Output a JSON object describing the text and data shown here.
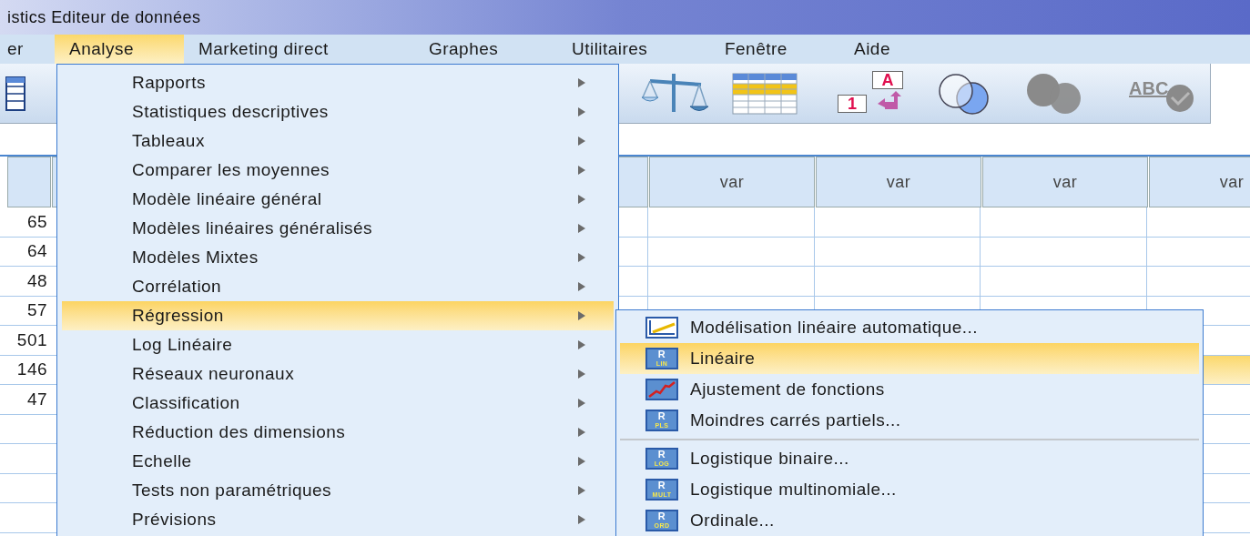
{
  "window": {
    "title": "istics Editeur de données"
  },
  "menu_bar": [
    {
      "label": "er",
      "selected": false
    },
    {
      "label": "Analyse",
      "selected": true
    },
    {
      "label": "Marketing direct",
      "selected": false
    },
    {
      "label": "Graphes",
      "selected": false
    },
    {
      "label": "Utilitaires",
      "selected": false
    },
    {
      "label": "Fenêtre",
      "selected": false
    },
    {
      "label": "Aide",
      "selected": false
    }
  ],
  "toolbar": [
    {
      "kind": "data-editor"
    },
    {
      "kind": "scale"
    },
    {
      "kind": "table"
    },
    {
      "kind": "value-labels",
      "labels": [
        "A",
        "1"
      ]
    },
    {
      "kind": "venn"
    },
    {
      "kind": "venn-disabled"
    },
    {
      "kind": "spell-check",
      "text": "ABC"
    }
  ],
  "grid": {
    "columns": [
      "var",
      "var",
      "var",
      "var"
    ],
    "rows": [
      {
        "column_1": "65",
        "selected": false
      },
      {
        "column_1": "64",
        "selected": false
      },
      {
        "column_1": "48",
        "selected": false
      },
      {
        "column_1": "57",
        "selected": false
      },
      {
        "column_1": "501",
        "selected": false
      },
      {
        "column_1": "146",
        "selected": true
      },
      {
        "column_1": "47",
        "selected": false
      }
    ]
  },
  "analyse_menu": {
    "items": [
      {
        "label": "Rapports",
        "selected": false
      },
      {
        "label": "Statistiques descriptives",
        "selected": false
      },
      {
        "label": "Tableaux",
        "selected": false
      },
      {
        "label": "Comparer les moyennes",
        "selected": false
      },
      {
        "label": "Modèle linéaire général",
        "selected": false
      },
      {
        "label": "Modèles linéaires généralisés",
        "selected": false
      },
      {
        "label": "Modèles Mixtes",
        "selected": false
      },
      {
        "label": "Corrélation",
        "selected": false
      },
      {
        "label": "Régression",
        "selected": true
      },
      {
        "label": "Log Linéaire",
        "selected": false
      },
      {
        "label": "Réseaux neuronaux",
        "selected": false
      },
      {
        "label": "Classification",
        "selected": false
      },
      {
        "label": "Réduction des dimensions",
        "selected": false
      },
      {
        "label": "Echelle",
        "selected": false
      },
      {
        "label": "Tests non paramétriques",
        "selected": false
      },
      {
        "label": "Prévisions",
        "selected": false
      }
    ]
  },
  "regression_submenu": {
    "items": [
      {
        "kind": "auto-model",
        "label": "Modélisation linéaire automatique...",
        "selected": false
      },
      {
        "kind": "regression",
        "badge": "R",
        "caption": "LIN",
        "label": "Linéaire",
        "selected": true
      },
      {
        "kind": "curve",
        "label": "Ajustement de fonctions",
        "selected": false
      },
      {
        "kind": "regression",
        "badge": "R",
        "caption": "PLS",
        "label": "Moindres carrés partiels...",
        "selected": false
      },
      {
        "kind": "separator"
      },
      {
        "kind": "regression",
        "badge": "R",
        "caption": "LOG",
        "label": "Logistique binaire...",
        "selected": false
      },
      {
        "kind": "regression",
        "badge": "R",
        "caption": "MULT",
        "label": "Logistique multinomiale...",
        "selected": false
      },
      {
        "kind": "regression",
        "badge": "R",
        "caption": "ORD",
        "label": "Ordinale...",
        "selected": false
      }
    ]
  }
}
